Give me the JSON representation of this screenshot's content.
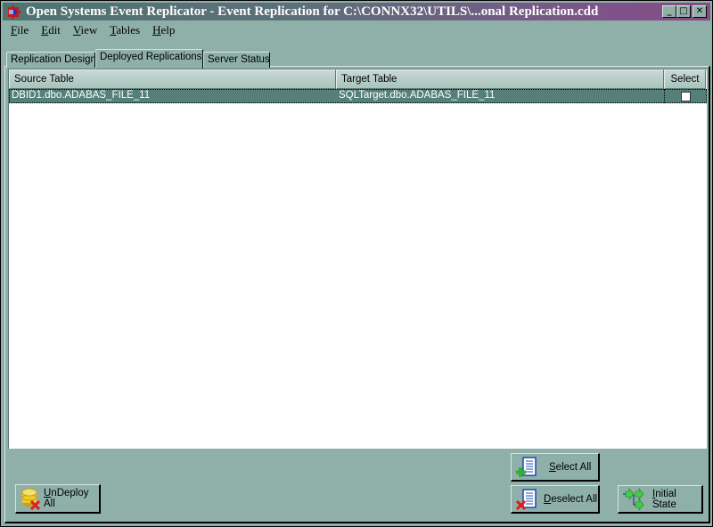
{
  "window": {
    "title": "Open Systems Event Replicator - Event Replication for C:\\CONNX32\\UTILS\\...onal Replication.cdd",
    "controls": {
      "minimize": "_",
      "maximize": "□",
      "close": "✕"
    }
  },
  "menu": [
    {
      "label": "File",
      "accel": "F",
      "rest": "ile"
    },
    {
      "label": "Edit",
      "accel": "E",
      "rest": "dit"
    },
    {
      "label": "View",
      "accel": "V",
      "rest": "iew"
    },
    {
      "label": "Tables",
      "accel": "T",
      "rest": "ables"
    },
    {
      "label": "Help",
      "accel": "H",
      "rest": "elp"
    }
  ],
  "tabs": [
    {
      "label": "Replication Design",
      "active": false
    },
    {
      "label": "Deployed Replications",
      "active": true
    },
    {
      "label": "Server Status",
      "active": false
    }
  ],
  "grid": {
    "columns": [
      "Source Table",
      "Target Table",
      "Select"
    ],
    "rows": [
      {
        "source": "DBID1.dbo.ADABAS_FILE_11",
        "target": "SQLTarget.dbo.ADABAS_FILE_11",
        "selected": false
      }
    ]
  },
  "buttons": {
    "undeploy_all": {
      "accel": "U",
      "rest": "nDeploy All",
      "icon": "database-remove-icon"
    },
    "select_all": {
      "accel": "S",
      "rest": "elect All",
      "icon": "list-add-icon"
    },
    "deselect_all": {
      "accel": "D",
      "rest": "eselect All",
      "icon": "list-remove-icon"
    },
    "initial_state": {
      "accel": "I",
      "rest": "nitial State",
      "icon": "flow-arrows-icon"
    }
  }
}
